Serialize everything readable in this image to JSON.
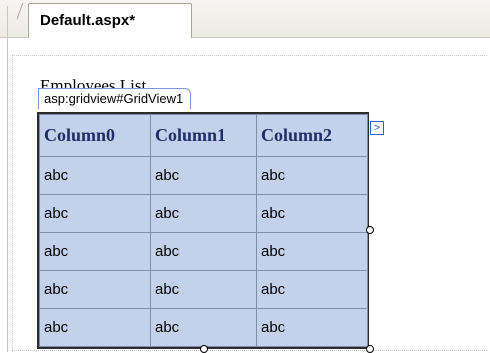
{
  "tab": {
    "title": "Default.aspx*"
  },
  "page": {
    "heading": "Employees List"
  },
  "control": {
    "tag_label": "asp:gridview#GridView1",
    "smart_tag_glyph": ">"
  },
  "grid": {
    "headers": [
      "Column0",
      "Column1",
      "Column2"
    ],
    "rows": [
      [
        "abc",
        "abc",
        "abc"
      ],
      [
        "abc",
        "abc",
        "abc"
      ],
      [
        "abc",
        "abc",
        "abc"
      ],
      [
        "abc",
        "abc",
        "abc"
      ],
      [
        "abc",
        "abc",
        "abc"
      ]
    ]
  },
  "colors": {
    "grid_fill": "#c3d2ea",
    "header_text": "#1d2f66",
    "selection_border": "#2b2b2b"
  }
}
